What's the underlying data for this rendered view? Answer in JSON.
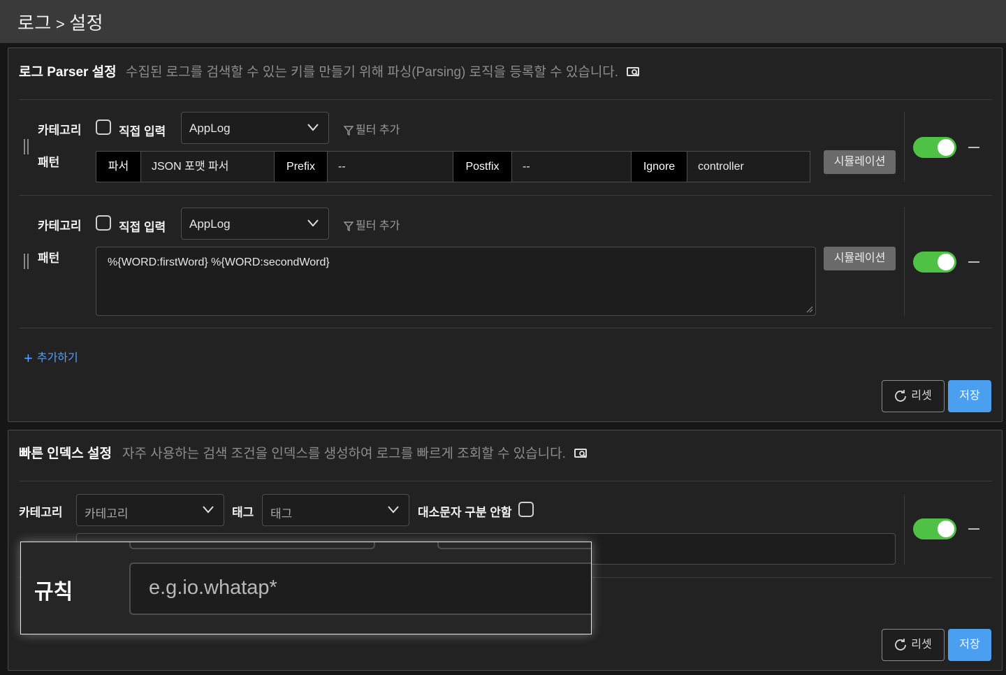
{
  "header": {
    "breadcrumb_root": "로그",
    "breadcrumb_sep": ">",
    "breadcrumb_current": "설정"
  },
  "parser_panel": {
    "title": "로그 Parser 설정",
    "description": "수집된 로그를 검색할 수 있는 키를 만들기 위해 파싱(Parsing) 로직을 등록할 수 있습니다.",
    "rows": [
      {
        "category_label": "카테고리",
        "direct_input_label": "직접 입력",
        "category_value": "AppLog",
        "filter_label": "필터 추가",
        "pattern_label": "패턴",
        "parser_label": "파서",
        "parser_value": "JSON 포맷 파서",
        "prefix_label": "Prefix",
        "prefix_value": "--",
        "postfix_label": "Postfix",
        "postfix_value": "--",
        "ignore_label": "Ignore",
        "ignore_value": "controller",
        "simulate_label": "시뮬레이션",
        "enabled": true
      },
      {
        "category_label": "카테고리",
        "direct_input_label": "직접 입력",
        "category_value": "AppLog",
        "filter_label": "필터 추가",
        "pattern_label": "패턴",
        "pattern_value": "%{WORD:firstWord} %{WORD:secondWord}",
        "simulate_label": "시뮬레이션",
        "enabled": true
      }
    ],
    "add_label": "추가하기",
    "reset_label": "리셋",
    "save_label": "저장"
  },
  "index_panel": {
    "title": "빠른 인덱스 설정",
    "description": "자주 사용하는 검색 조건을 인덱스를 생성하여 로그를 빠르게 조회할 수 있습니다.",
    "category_label": "카테고리",
    "category_placeholder": "카테고리",
    "tag_label": "태그",
    "tag_placeholder": "태그",
    "case_insensitive_label": "대소문자 구분 안함",
    "rule_label": "규칙",
    "rule_placeholder": "e.g.io.whatap*",
    "enabled": true,
    "reset_label": "리셋",
    "save_label": "저장"
  },
  "colors": {
    "accent": "#4b9ff0",
    "toggle_on": "#4fc246",
    "panel_bg": "#222222",
    "page_bg": "#161616"
  }
}
